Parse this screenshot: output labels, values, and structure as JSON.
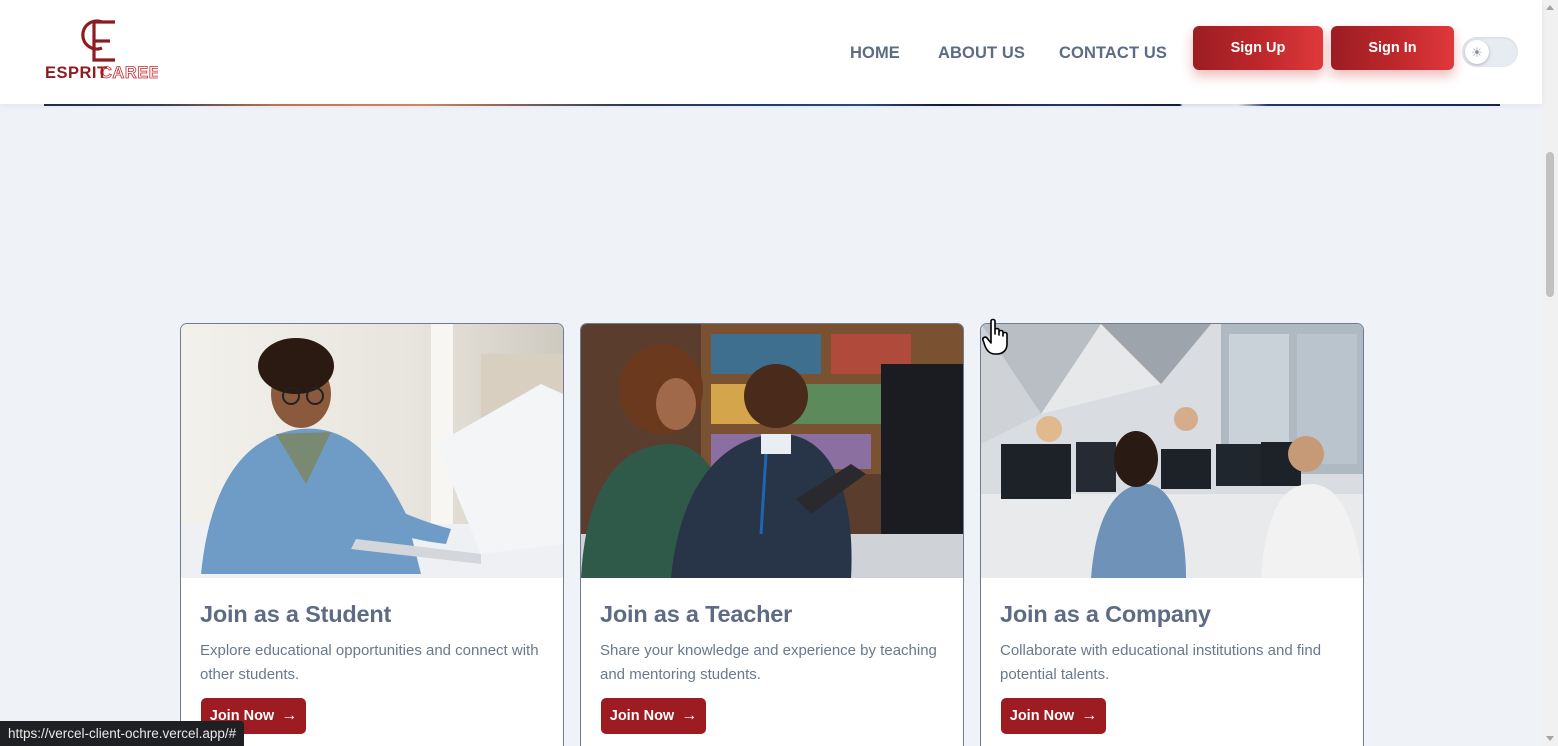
{
  "header": {
    "logo_text": "ESPRIT CAREER",
    "nav": [
      {
        "label": "HOME"
      },
      {
        "label": "ABOUT US"
      },
      {
        "label": "CONTACT US"
      }
    ],
    "signup_label": "Sign Up",
    "signin_label": "Sign In",
    "theme_toggle": {
      "state": "light",
      "icon": "sun-icon"
    }
  },
  "cards": [
    {
      "title": "Join as a Student",
      "description": "Explore educational opportunities and connect with other students.",
      "button": "Join Now",
      "image": "student-laptop-photo"
    },
    {
      "title": "Join as a Teacher",
      "description": "Share your knowledge and experience by teaching and mentoring students.",
      "button": "Join Now",
      "image": "teacher-mentoring-photo"
    },
    {
      "title": "Join as a Company",
      "description": "Collaborate with educational institutions and find potential talents.",
      "button": "Join Now",
      "image": "company-office-photo"
    }
  ],
  "status_bar": {
    "url": "https://vercel-client-ochre.vercel.app/#"
  },
  "colors": {
    "brand_red": "#9d1c22",
    "page_bg": "#eff3f8",
    "text_slate": "#5d6b85"
  }
}
